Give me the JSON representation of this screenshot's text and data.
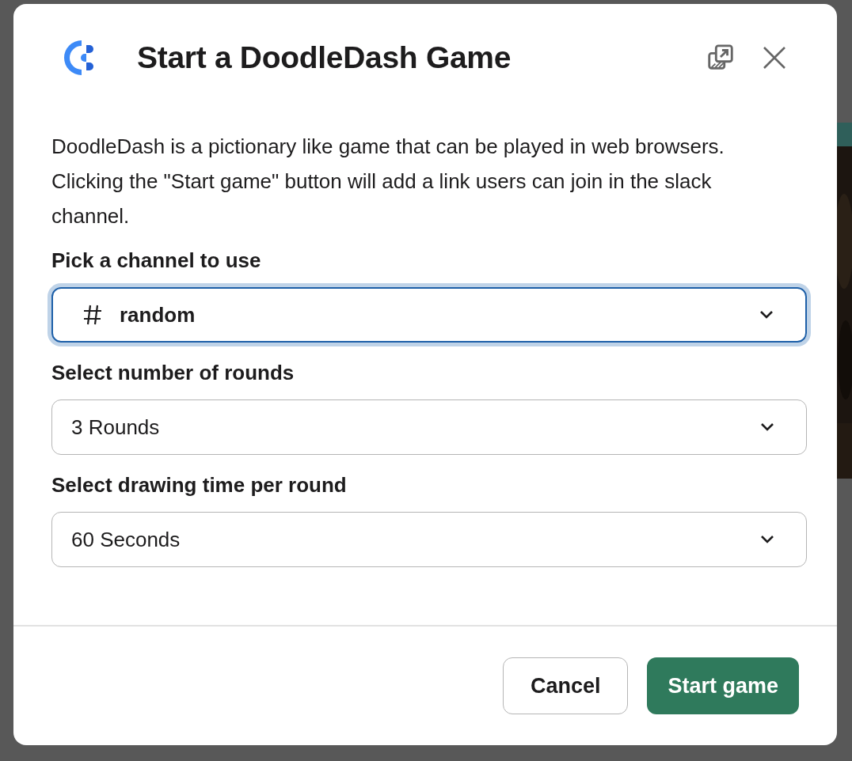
{
  "dialog": {
    "title": "Start a DoodleDash Game",
    "description": "DoodleDash is a pictionary like game that can be played in web browsers. Clicking the \"Start game\" button will add a link users can join in the slack channel.",
    "fields": [
      {
        "label": "Pick a channel to use",
        "value": "random",
        "kind": "channel",
        "focused": true
      },
      {
        "label": "Select number of rounds",
        "value": "3 Rounds",
        "kind": "plain",
        "focused": false
      },
      {
        "label": "Select drawing time per round",
        "value": "60 Seconds",
        "kind": "plain",
        "focused": false
      }
    ],
    "buttons": [
      {
        "label": "Cancel",
        "kind": "secondary"
      },
      {
        "label": "Start game",
        "kind": "primary"
      }
    ]
  }
}
